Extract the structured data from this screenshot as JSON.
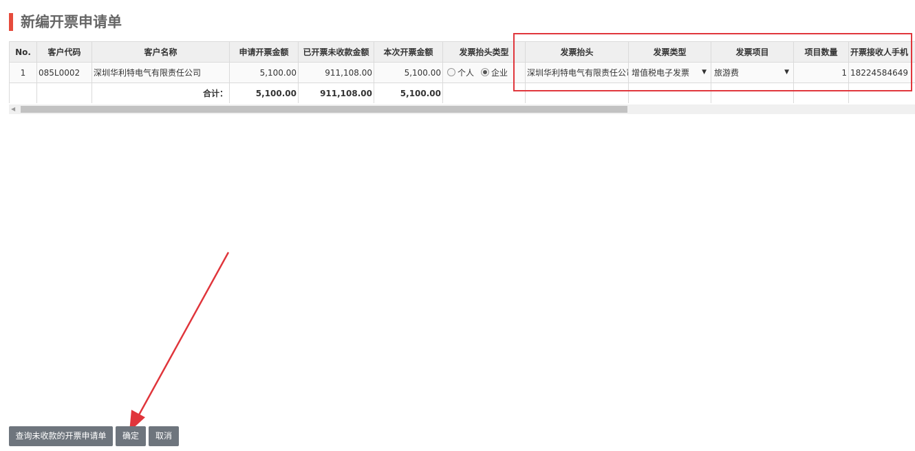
{
  "page": {
    "title": "新编开票申请单"
  },
  "table": {
    "headers": [
      "No.",
      "客户代码",
      "客户名称",
      "申请开票金额",
      "已开票未收款金额",
      "本次开票金额",
      "发票抬头类型",
      "发票抬头",
      "发票类型",
      "发票项目",
      "项目数量",
      "开票接收人手机"
    ],
    "row": {
      "no": "1",
      "customer_code": "085L0002",
      "customer_name": "深圳华利特电气有限责任公司",
      "apply_amount": "5,100.00",
      "unpaid_amount": "911,108.00",
      "current_amount": "5,100.00",
      "header_type_options": [
        "个人",
        "企业"
      ],
      "header_type_selected": "企业",
      "invoice_header": "深圳华利特电气有限责任公司",
      "invoice_type": "增值税电子发票",
      "invoice_item": "旅游费",
      "item_quantity": "1",
      "receiver_phone": "18224584649"
    },
    "total": {
      "label": "合计：",
      "apply_amount": "5,100.00",
      "unpaid_amount": "911,108.00",
      "current_amount": "5,100.00"
    }
  },
  "buttons": {
    "query_unpaid": "查询未收款的开票申请单",
    "confirm": "确定",
    "cancel": "取消"
  },
  "colors": {
    "accent": "#e64b3c",
    "highlight": "#e0353b",
    "button": "#6e757d"
  }
}
